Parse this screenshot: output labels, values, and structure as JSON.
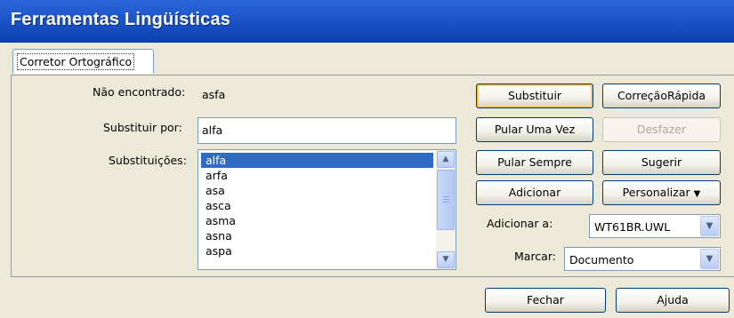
{
  "window": {
    "title": "Ferramentas Lingüísticas"
  },
  "tabs": [
    {
      "label": "Corretor Ortográfico"
    }
  ],
  "form": {
    "not_found_label": "Não encontrado:",
    "not_found_value": "asfa",
    "replace_with_label": "Substituir por:",
    "replace_with_value": "alfa",
    "suggestions_label": "Substituições:"
  },
  "suggestions": [
    "alfa",
    "arfa",
    "asa",
    "asca",
    "asma",
    "asna",
    "aspa"
  ],
  "selected_suggestion": "alfa",
  "buttons": {
    "replace": "Substituir",
    "quick_correct": "CorreçãoRápida",
    "skip_once": "Pular Uma Vez",
    "undo": "Desfazer",
    "skip_always": "Pular Sempre",
    "suggest": "Sugerir",
    "add": "Adicionar",
    "customize": "Personalizar",
    "close": "Fechar",
    "help": "Ajuda"
  },
  "add_to": {
    "label": "Adicionar a:",
    "value": "WT61BR.UWL"
  },
  "mark": {
    "label": "Marcar:",
    "value": "Documento"
  },
  "icons": {
    "scroll_up": "chevron-up-icon",
    "scroll_down": "chevron-down-icon",
    "dropdown": "chevron-down-icon",
    "menu_arrow": "triangle-down-icon"
  },
  "colors": {
    "titlebar": "#0c3fb1",
    "selection": "#316ac5",
    "dialog_bg": "#ece9d8",
    "focus_ring": "#f8b636"
  }
}
